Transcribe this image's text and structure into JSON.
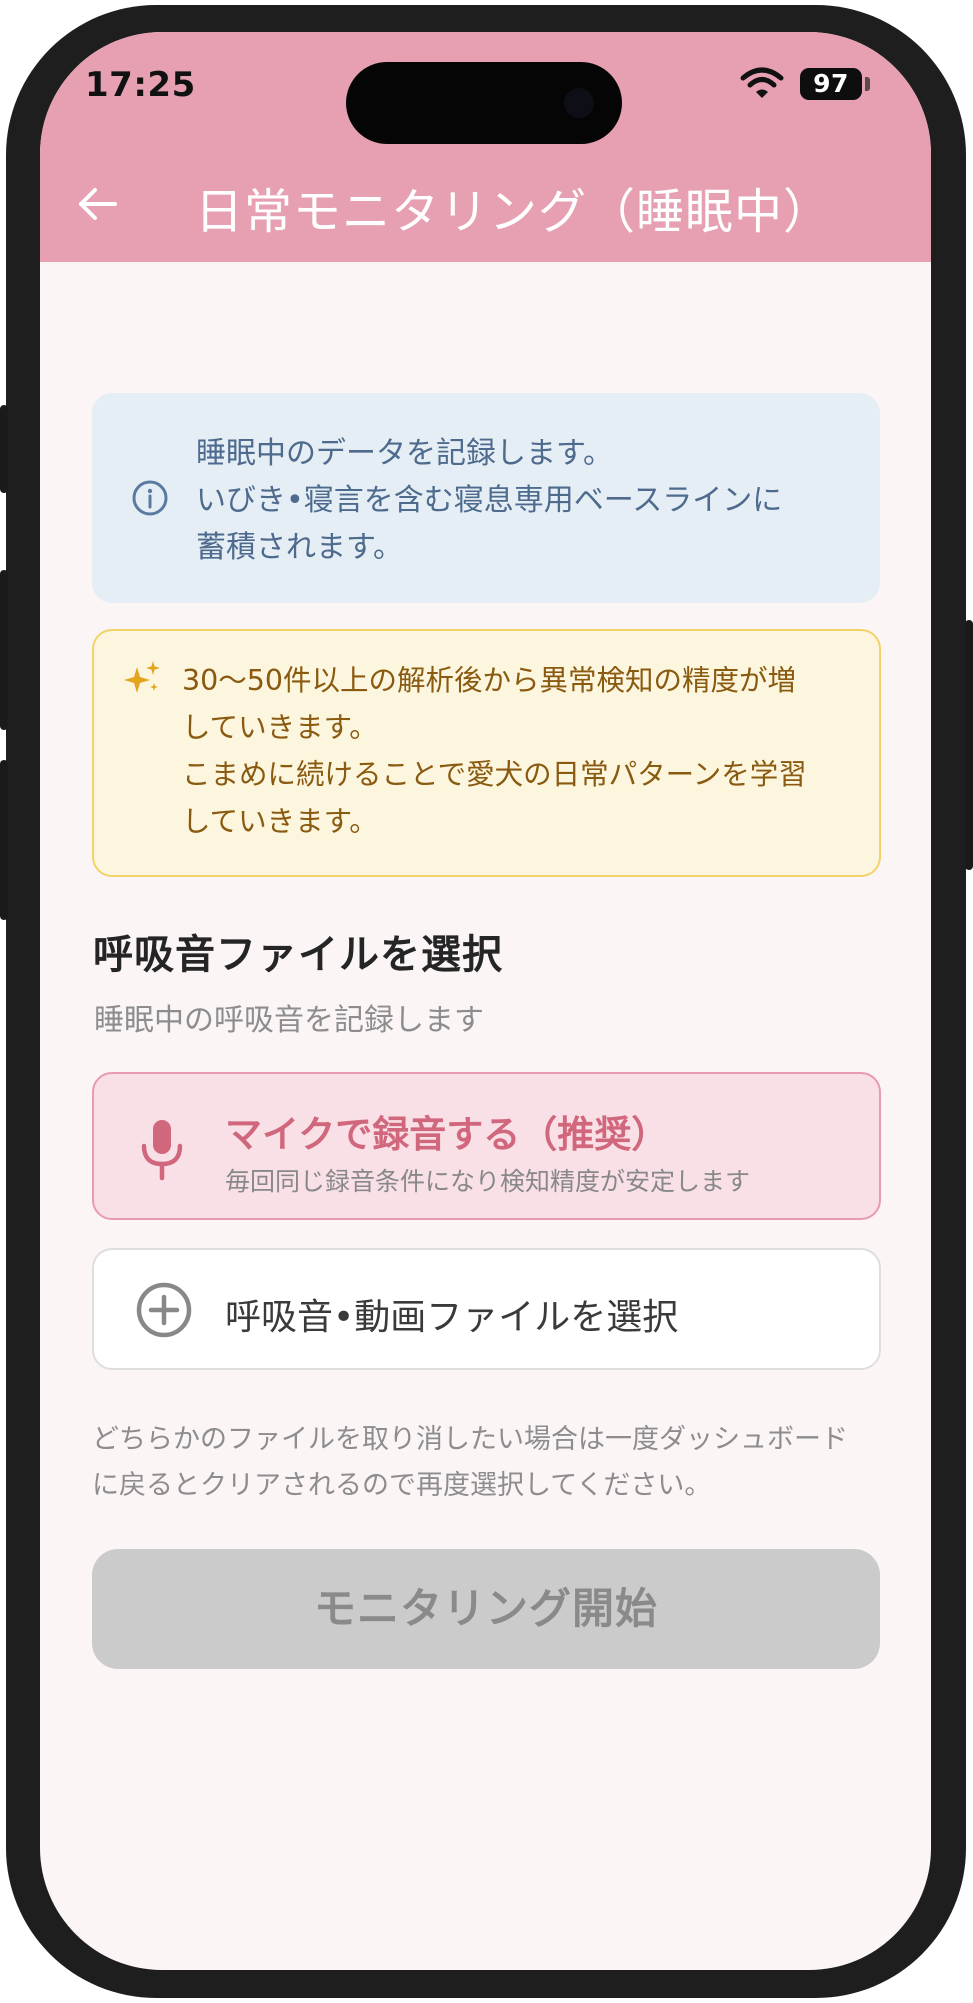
{
  "status_bar": {
    "time": "17:25",
    "battery": "97"
  },
  "app_bar": {
    "title": "日常モニタリング（睡眠中）"
  },
  "info_card": {
    "lines": [
      "睡眠中のデータを記録します。",
      "いびき•寝言を含む寝息専用ベースラインに",
      "蓄積されます。"
    ]
  },
  "tip_card": {
    "lines": [
      "30〜50件以上の解析後から異常検知の精度が増",
      "していきます。",
      "こまめに続けることで愛犬の日常パターンを学習",
      "していきます。"
    ]
  },
  "section": {
    "title": "呼吸音ファイルを選択",
    "subtitle": "睡眠中の呼吸音を記録します"
  },
  "mic_button": {
    "label": "マイクで録音する（推奨）",
    "sublabel": "毎回同じ録音条件になり検知精度が安定します"
  },
  "file_button": {
    "label": "呼吸音•動画ファイルを選択"
  },
  "note": {
    "lines": [
      "どちらかのファイルを取り消したい場合は一度ダッシュボード",
      "に戻るとクリアされるので再度選択してください。"
    ]
  },
  "start_button": {
    "label": "モニタリング開始"
  },
  "icons": {
    "back": "arrow-left-icon",
    "info": "info-circle-icon",
    "sparkle": "sparkle-icon",
    "mic": "microphone-icon",
    "add": "plus-circle-icon"
  },
  "colors": {
    "app_bar": "#e7a0b1",
    "background": "#fcf5f6",
    "info_bg": "#e5eef5",
    "tip_bg": "#fdf6df",
    "tip_border": "#f2d36a",
    "accent": "#d1677d",
    "disabled_button": "#cbcbcb"
  }
}
